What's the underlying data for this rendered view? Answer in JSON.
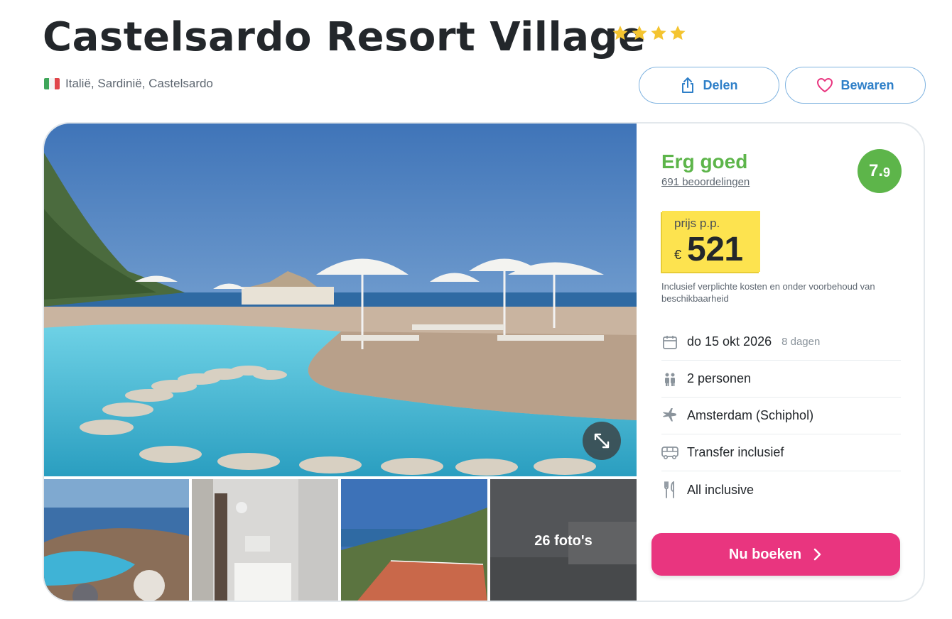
{
  "hotel": {
    "name": "Castelsardo Resort Village",
    "stars": 4,
    "location": "Italië, Sardinië, Castelsardo"
  },
  "actions": {
    "share_label": "Delen",
    "save_label": "Bewaren"
  },
  "gallery": {
    "photo_count_label": "26 foto's"
  },
  "rating": {
    "label": "Erg goed",
    "reviews_label": "691 beoordelingen",
    "score_main": "7.",
    "score_decimal": "9"
  },
  "price": {
    "label": "prijs p.p.",
    "currency": "€",
    "amount": "521",
    "note": "Inclusief verplichte kosten en onder voorbehoud van beschikbaarheid"
  },
  "details": {
    "date": "do 15 okt 2026",
    "duration": "8 dagen",
    "persons": "2 personen",
    "departure": "Amsterdam (Schiphol)",
    "transfer": "Transfer inclusief",
    "board": "All inclusive"
  },
  "cta": {
    "book_label": "Nu boeken"
  },
  "colors": {
    "accent_pink": "#e9357f",
    "rating_green": "#5db54a",
    "price_yellow": "#fde34f",
    "link_blue": "#2e7fc8",
    "star_gold": "#f4c430"
  }
}
